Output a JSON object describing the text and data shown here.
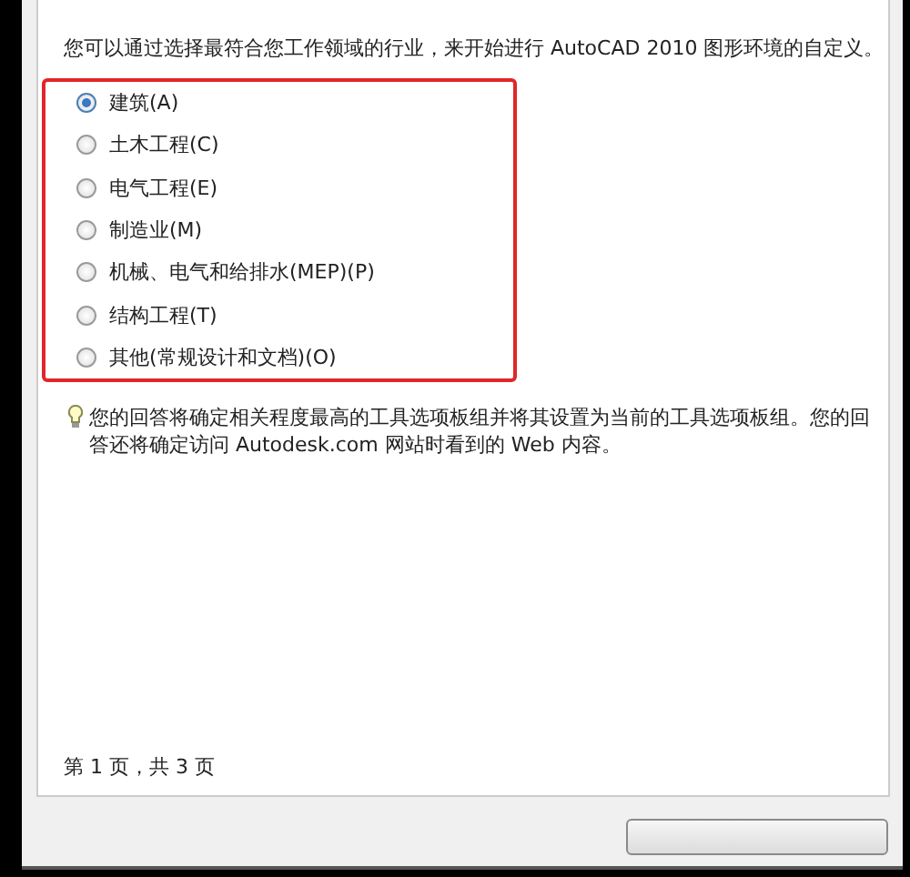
{
  "intro": "您可以通过选择最符合您工作领域的行业，来开始进行 AutoCAD 2010 图形环境的自定义。",
  "options": [
    {
      "label": "建筑(A)",
      "selected": true
    },
    {
      "label": "土木工程(C)",
      "selected": false
    },
    {
      "label": "电气工程(E)",
      "selected": false
    },
    {
      "label": "制造业(M)",
      "selected": false
    },
    {
      "label": "机械、电气和给排水(MEP)(P)",
      "selected": false
    },
    {
      "label": "结构工程(T)",
      "selected": false
    },
    {
      "label": "其他(常规设计和文档)(O)",
      "selected": false
    }
  ],
  "tip": "您的回答将确定相关程度最高的工具选项板组并将其设置为当前的工具选项板组。您的回答还将确定访问 Autodesk.com 网站时看到的 Web 内容。",
  "page_status": "第 1 页，共 3 页"
}
